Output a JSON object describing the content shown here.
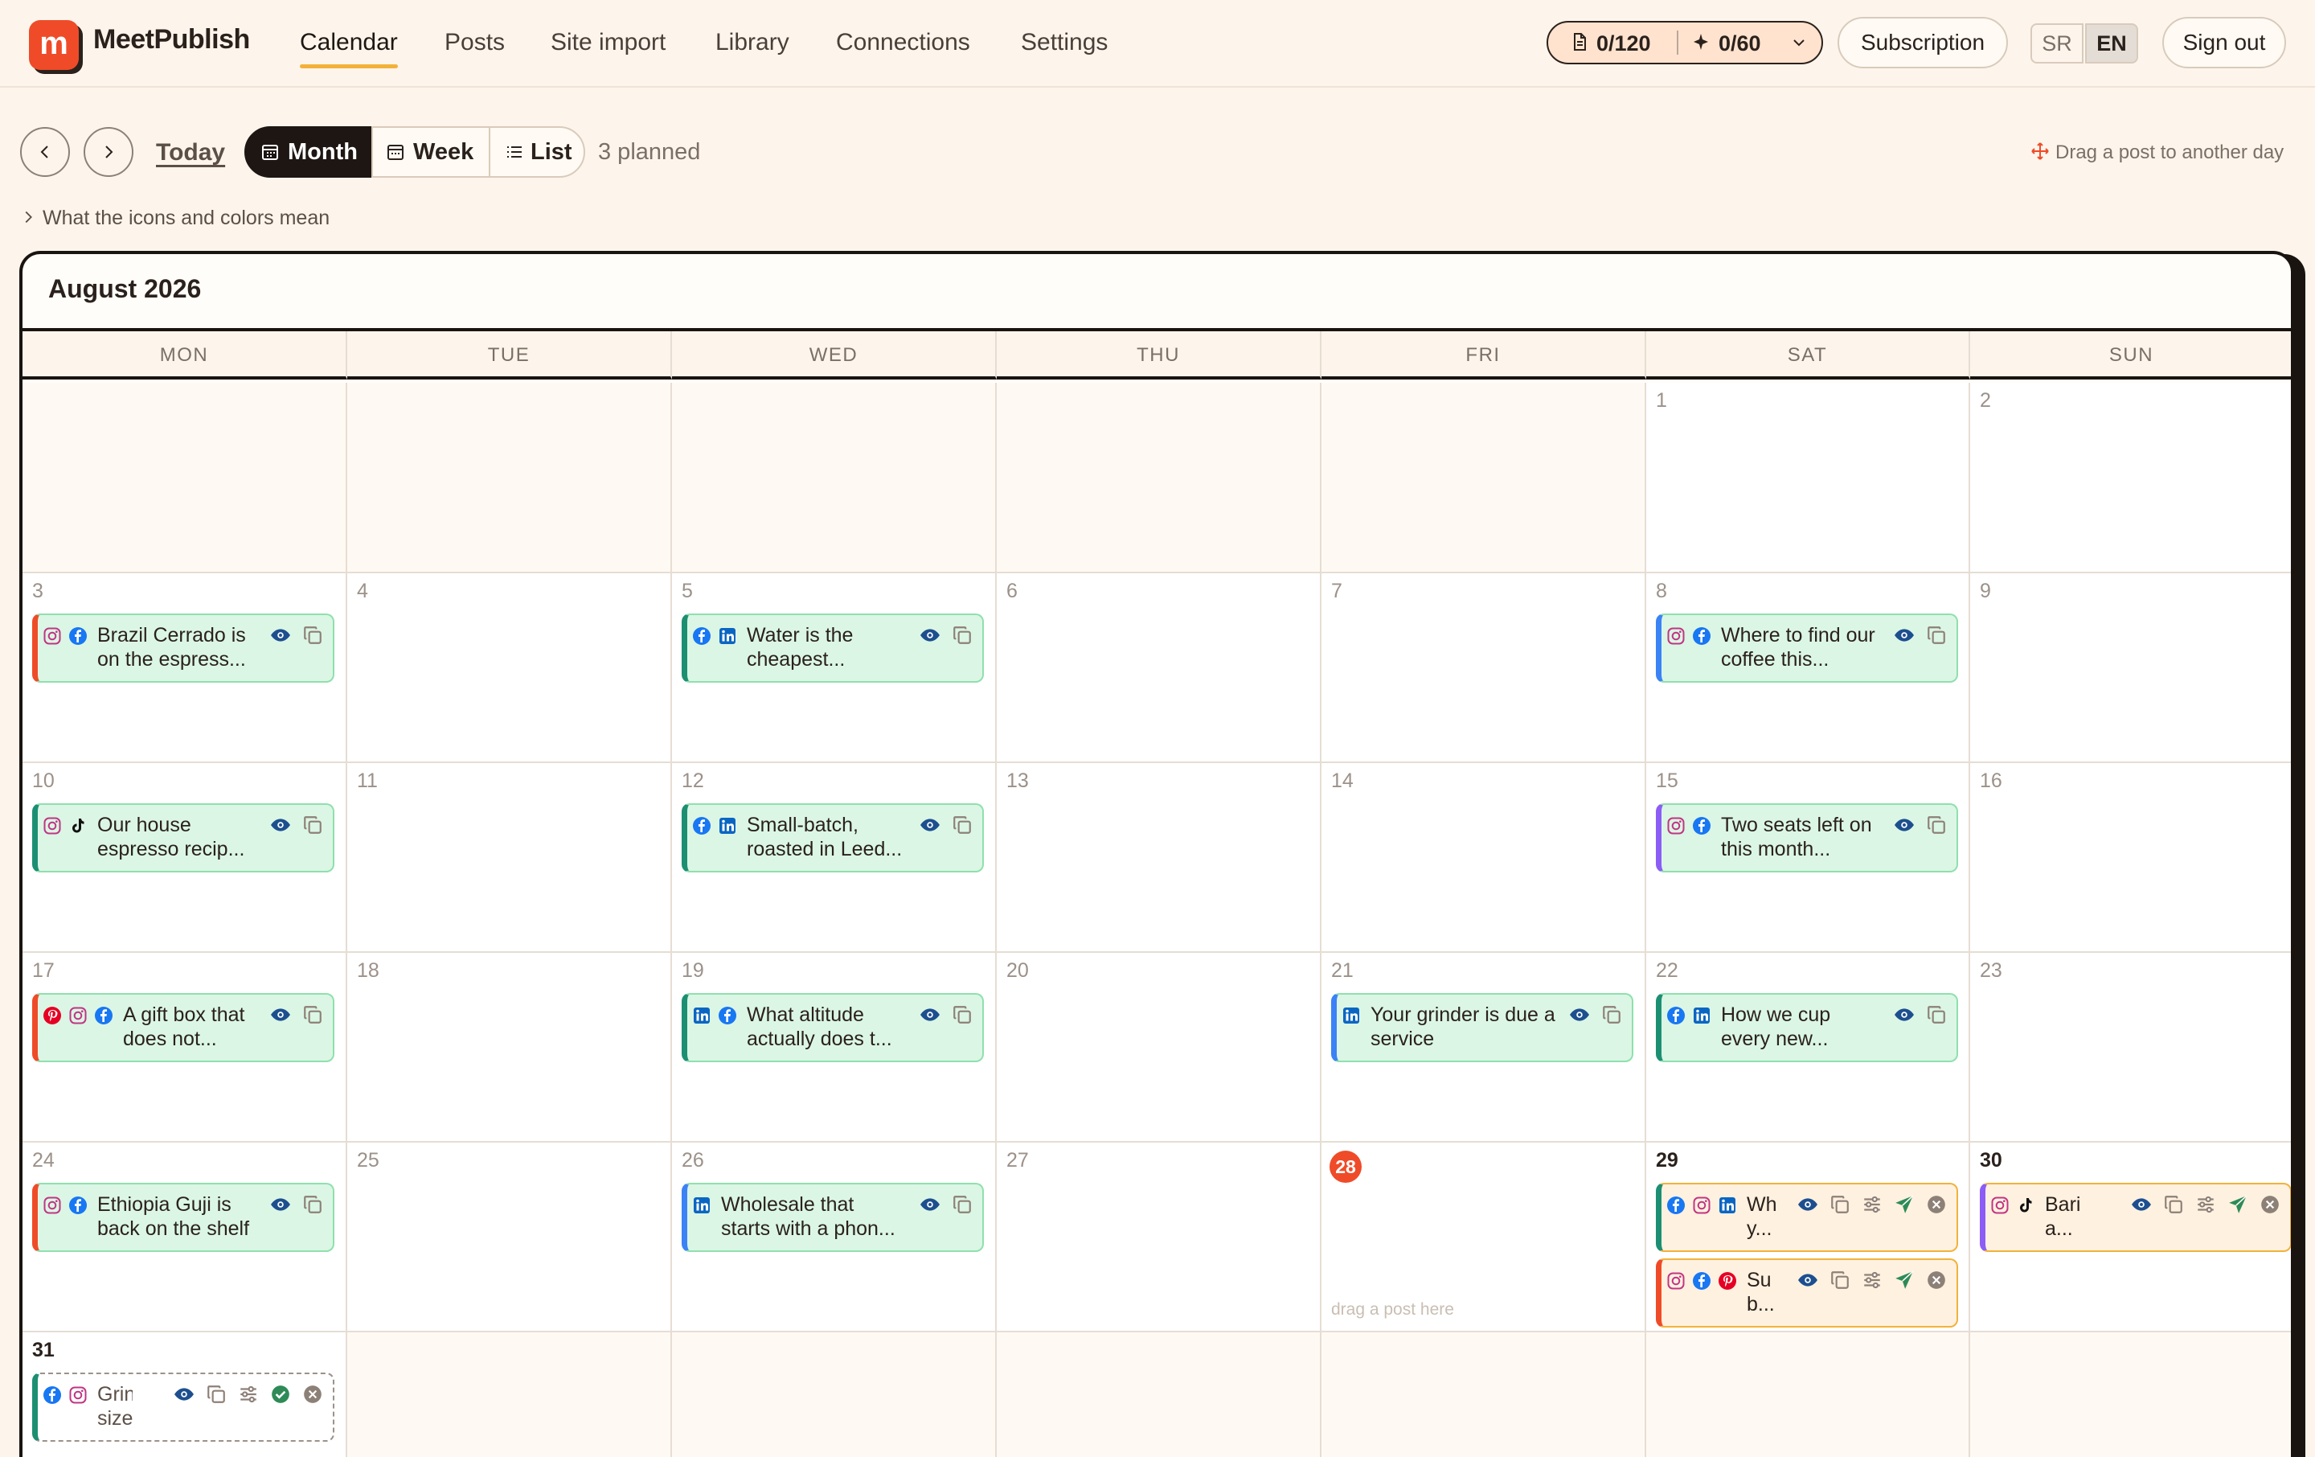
{
  "app": {
    "logo_letter": "m",
    "name": "MeetPublish"
  },
  "nav": [
    {
      "label": "Calendar",
      "active": true
    },
    {
      "label": "Posts"
    },
    {
      "label": "Site import"
    },
    {
      "label": "Library"
    },
    {
      "label": "Connections"
    },
    {
      "label": "Settings"
    }
  ],
  "quota": {
    "posts": "0/120",
    "ai": "0/60"
  },
  "subscription_label": "Subscription",
  "languages": [
    "SR",
    "EN"
  ],
  "active_language": "EN",
  "signout_label": "Sign out",
  "toolbar": {
    "today": "Today",
    "views": [
      "Month",
      "Week",
      "List"
    ],
    "active_view": "Month",
    "planned": "3 planned",
    "drag_hint": "Drag a post to another day"
  },
  "legend_toggle": "What the icons and colors mean",
  "calendar": {
    "title": "August 2026",
    "weekdays": [
      "MON",
      "TUE",
      "WED",
      "THU",
      "FRI",
      "SAT",
      "SUN"
    ],
    "today_day": "28",
    "drop_hint": "drag a post here",
    "weeks": [
      [
        {
          "out": true
        },
        {
          "out": true
        },
        {
          "out": true
        },
        {
          "out": true
        },
        {
          "out": true
        },
        {
          "day": "1"
        },
        {
          "day": "2"
        }
      ],
      [
        {
          "day": "3",
          "posts": [
            {
              "text": "Brazil Cerrado is on the espress...",
              "icons": [
                "instagram",
                "facebook"
              ],
              "stripe": "#ef4b28"
            }
          ]
        },
        {
          "day": "4"
        },
        {
          "day": "5",
          "posts": [
            {
              "text": "Water is the cheapest...",
              "icons": [
                "facebook",
                "linkedin"
              ],
              "stripe": "#1c8f73"
            }
          ]
        },
        {
          "day": "6"
        },
        {
          "day": "7"
        },
        {
          "day": "8",
          "posts": [
            {
              "text": "Where to find our coffee this...",
              "icons": [
                "instagram",
                "facebook"
              ],
              "stripe": "#3b82f6"
            }
          ]
        },
        {
          "day": "9"
        }
      ],
      [
        {
          "day": "10",
          "posts": [
            {
              "text": "Our house espresso recip...",
              "icons": [
                "instagram",
                "tiktok"
              ],
              "stripe": "#1c8f73"
            }
          ]
        },
        {
          "day": "11"
        },
        {
          "day": "12",
          "posts": [
            {
              "text": "Small-batch, roasted in Leed...",
              "icons": [
                "facebook",
                "linkedin"
              ],
              "stripe": "#1c8f73"
            }
          ]
        },
        {
          "day": "13"
        },
        {
          "day": "14"
        },
        {
          "day": "15",
          "posts": [
            {
              "text": "Two seats left on this month...",
              "icons": [
                "instagram",
                "facebook"
              ],
              "stripe": "#8b5cf6"
            }
          ]
        },
        {
          "day": "16"
        }
      ],
      [
        {
          "day": "17",
          "posts": [
            {
              "text": "A gift box that does not...",
              "icons": [
                "pinterest",
                "instagram",
                "facebook"
              ],
              "stripe": "#ef4b28"
            }
          ]
        },
        {
          "day": "18"
        },
        {
          "day": "19",
          "posts": [
            {
              "text": "What altitude actually does t...",
              "icons": [
                "linkedin",
                "facebook"
              ],
              "stripe": "#1c8f73"
            }
          ]
        },
        {
          "day": "20"
        },
        {
          "day": "21",
          "posts": [
            {
              "text": "Your grinder is due a service",
              "icons": [
                "linkedin"
              ],
              "stripe": "#3b82f6"
            }
          ]
        },
        {
          "day": "22",
          "posts": [
            {
              "text": "How we cup every new...",
              "icons": [
                "facebook",
                "linkedin"
              ],
              "stripe": "#1c8f73"
            }
          ]
        },
        {
          "day": "23"
        }
      ],
      [
        {
          "day": "24",
          "posts": [
            {
              "text": "Ethiopia Guji is back on the shelf",
              "icons": [
                "instagram",
                "facebook"
              ],
              "stripe": "#ef4b28"
            }
          ]
        },
        {
          "day": "25"
        },
        {
          "day": "26",
          "posts": [
            {
              "text": "Wholesale that starts with a phon...",
              "icons": [
                "linkedin"
              ],
              "stripe": "#3b82f6"
            }
          ]
        },
        {
          "day": "27"
        },
        {
          "day": "28",
          "today": true
        },
        {
          "day": "29",
          "posts": [
            {
              "text": "Wh y...",
              "icons": [
                "facebook",
                "instagram",
                "linkedin"
              ],
              "stripe": "#1c8f73",
              "pending": true
            },
            {
              "text": "Su b...",
              "icons": [
                "instagram",
                "facebook",
                "pinterest"
              ],
              "stripe": "#ef4b28",
              "pending": true
            }
          ]
        },
        {
          "day": "30",
          "posts": [
            {
              "text": "Barist a...",
              "icons": [
                "instagram",
                "tiktok"
              ],
              "stripe": "#8b5cf6",
              "pending": true
            }
          ]
        }
      ],
      [
        {
          "day": "31",
          "posts": [
            {
              "text": "Grind size i...",
              "icons": [
                "facebook",
                "instagram"
              ],
              "stripe": "#1c8f73",
              "draft": true
            }
          ]
        },
        {
          "out": true
        },
        {
          "out": true
        },
        {
          "out": true
        },
        {
          "out": true
        },
        {
          "out": true
        },
        {
          "out": true
        }
      ]
    ]
  }
}
